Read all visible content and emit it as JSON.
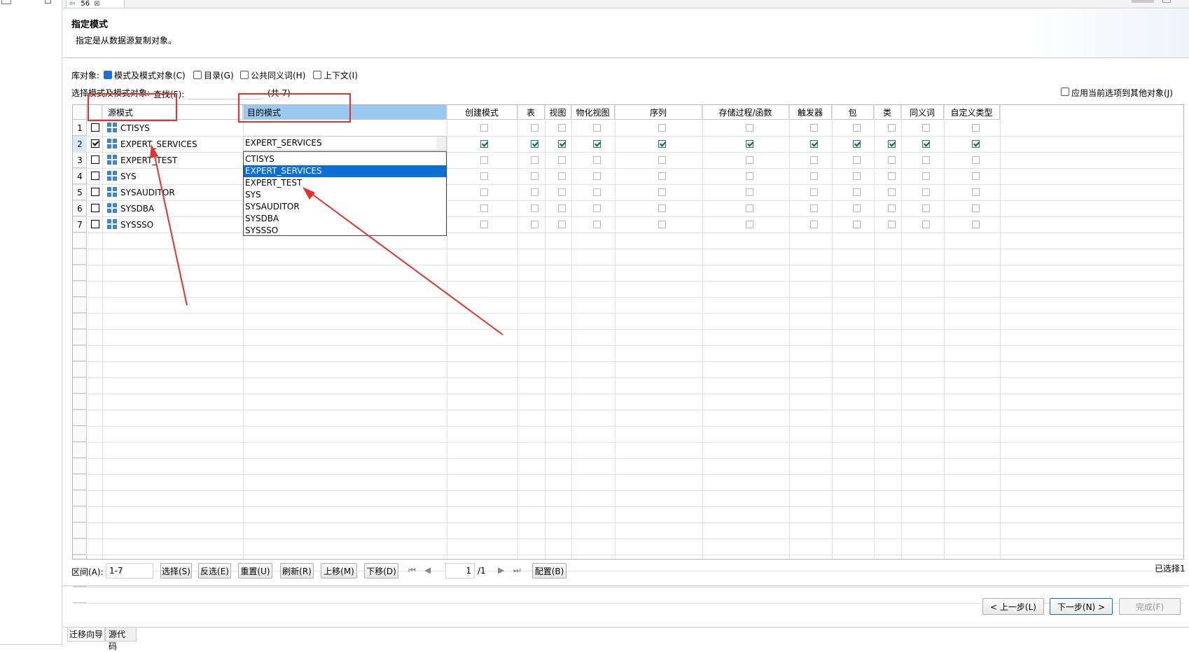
{
  "tab": {
    "label": "56"
  },
  "header": {
    "title": "指定模式",
    "subtitle": "指定是从数据源复制对象。"
  },
  "lib_objects": {
    "label": "库对象:",
    "options": [
      {
        "label": "模式及模式对象(C)",
        "checked": true
      },
      {
        "label": "目录(G)",
        "checked": false
      },
      {
        "label": "公共同义词(H)",
        "checked": false
      },
      {
        "label": "上下文(I)",
        "checked": false
      }
    ]
  },
  "filter": {
    "label": "选择模式及模式对象:",
    "search_label": "查找(F):",
    "search_value": "",
    "count": "(共 7)"
  },
  "apply_all": {
    "label": "应用当前选项到其他对象(J)",
    "checked": false
  },
  "columns": [
    "源模式",
    "目的模式",
    "创建模式",
    "表",
    "视图",
    "物化视图",
    "序列",
    "存储过程/函数",
    "触发器",
    "包",
    "类",
    "同义词",
    "自定义类型"
  ],
  "rows": [
    {
      "num": "1",
      "checked": false,
      "source": "CTISYS",
      "target": "",
      "flags": false
    },
    {
      "num": "2",
      "checked": true,
      "source": "EXPERT_SERVICES",
      "target": "EXPERT_SERVICES",
      "flags": true
    },
    {
      "num": "3",
      "checked": false,
      "source": "EXPERT_TEST",
      "target": "",
      "flags": false
    },
    {
      "num": "4",
      "checked": false,
      "source": "SYS",
      "target": "",
      "flags": false
    },
    {
      "num": "5",
      "checked": false,
      "source": "SYSAUDITOR",
      "target": "",
      "flags": false
    },
    {
      "num": "6",
      "checked": false,
      "source": "SYSDBA",
      "target": "",
      "flags": false
    },
    {
      "num": "7",
      "checked": false,
      "source": "SYSSSO",
      "target": "",
      "flags": false
    }
  ],
  "dropdown": {
    "options": [
      "CTISYS",
      "EXPERT_SERVICES",
      "EXPERT_TEST",
      "SYS",
      "SYSAUDITOR",
      "SYSDBA",
      "SYSSSO"
    ],
    "selected": "EXPERT_SERVICES"
  },
  "bottom_bar": {
    "range_label": "区间(A):",
    "range_value": "1-7",
    "buttons": [
      "选择(S)",
      "反选(E)",
      "重置(U)",
      "刷新(R)",
      "上移(M)",
      "下移(D)"
    ],
    "page_value": "1",
    "page_total": "/1",
    "config": "配置(B)",
    "selected_count": "已选择1"
  },
  "wizard": {
    "prev": "< 上一步(L)",
    "next": "下一步(N) >",
    "finish": "完成(F)"
  },
  "bottom_tabs": [
    "迁移向导",
    "源代码"
  ],
  "colors": {
    "accent": "#0b6fd6",
    "header_highlight": "#99c9ef",
    "annotation": "#e8302a"
  }
}
